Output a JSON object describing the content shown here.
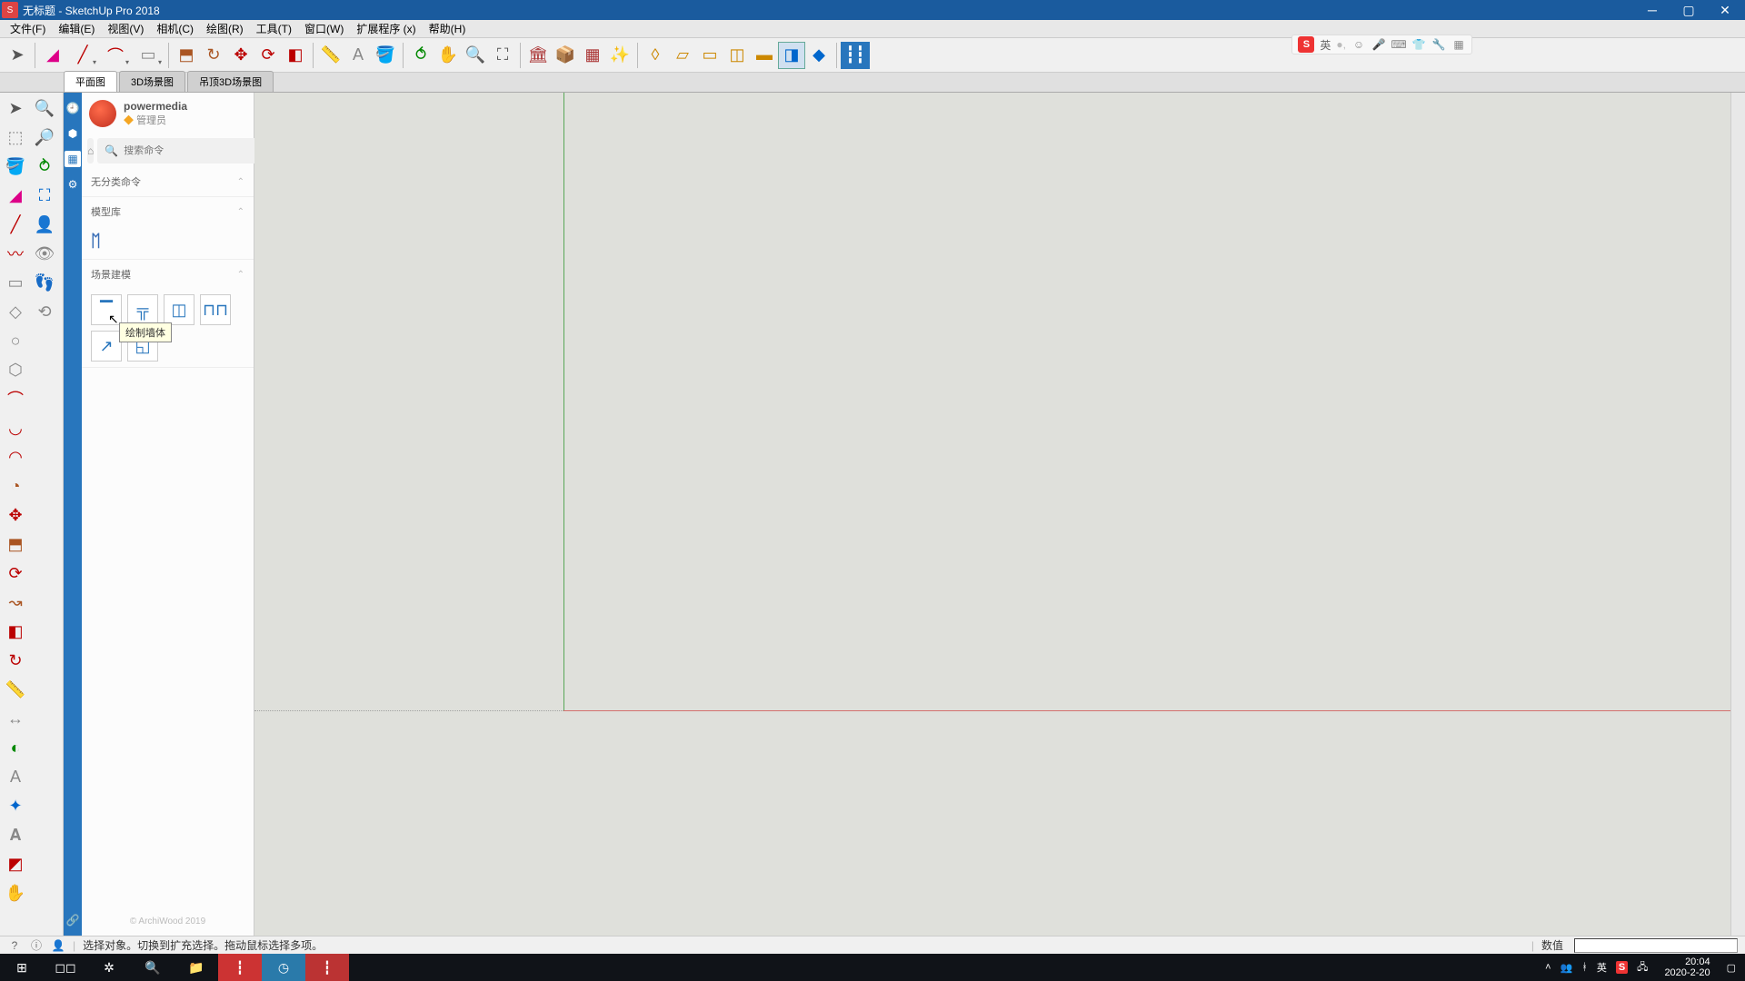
{
  "title": "无标题 - SketchUp Pro 2018",
  "menus": [
    "文件(F)",
    "编辑(E)",
    "视图(V)",
    "相机(C)",
    "绘图(R)",
    "工具(T)",
    "窗口(W)",
    "扩展程序 (x)",
    "帮助(H)"
  ],
  "scene_tabs": [
    "平面图",
    "3D场景图",
    "吊顶3D场景图"
  ],
  "user": {
    "name": "powermedia",
    "role": "管理员"
  },
  "search": {
    "placeholder": "搜索命令"
  },
  "sections": {
    "uncategorized": "无分类命令",
    "library": "模型库",
    "scene_build": "场景建模"
  },
  "tooltip": "绘制墙体",
  "footer": "© ArchiWood 2019",
  "status": {
    "msg": "选择对象。切换到扩充选择。拖动鼠标选择多项。",
    "value_label": "数值"
  },
  "clock": {
    "time": "20:04",
    "date": "2020-2-20"
  },
  "ime": {
    "lang": "英",
    "tray_lang": "英"
  }
}
